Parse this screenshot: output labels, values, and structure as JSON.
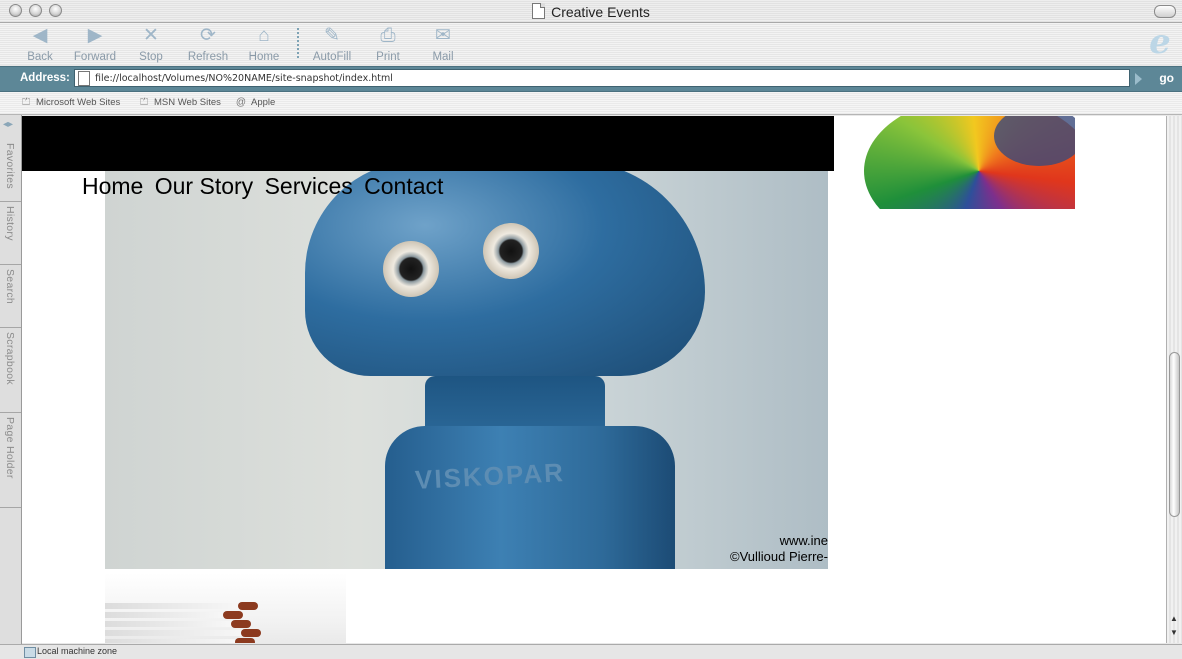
{
  "window": {
    "title": "Creative Events"
  },
  "toolbar": {
    "buttons": [
      {
        "label": "Back",
        "icon": "back-arrow-icon"
      },
      {
        "label": "Forward",
        "icon": "forward-arrow-icon"
      },
      {
        "label": "Stop",
        "icon": "stop-x-icon"
      },
      {
        "label": "Refresh",
        "icon": "refresh-icon"
      },
      {
        "label": "Home",
        "icon": "home-icon"
      },
      {
        "label": "AutoFill",
        "icon": "autofill-icon"
      },
      {
        "label": "Print",
        "icon": "printer-icon"
      },
      {
        "label": "Mail",
        "icon": "mail-icon"
      }
    ]
  },
  "address": {
    "label": "Address:",
    "url": "file://localhost/Volumes/NO%20NAME/site-snapshot/index.html",
    "go_label": "go"
  },
  "favorites_bar": {
    "items": [
      {
        "label": "Microsoft Web Sites",
        "icon": "folder-icon"
      },
      {
        "label": "MSN Web Sites",
        "icon": "folder-icon"
      },
      {
        "label": "Apple",
        "icon": "at-icon"
      }
    ]
  },
  "sidebar_tabs": [
    "Favorites",
    "History",
    "Search",
    "Scrapbook",
    "Page Holder"
  ],
  "page": {
    "nav": [
      "Home",
      "Our Story",
      "Services",
      "Contact"
    ],
    "hero": {
      "brand_text": "VISKOPAR",
      "credit_line1": "www.ine",
      "credit_line2": "©Vullioud Pierre-"
    }
  },
  "status": {
    "text": "Local machine zone"
  },
  "colors": {
    "address_bar": "#5d8797",
    "toolbar_icon": "#9fb6c8",
    "page_header_band": "#000000"
  }
}
